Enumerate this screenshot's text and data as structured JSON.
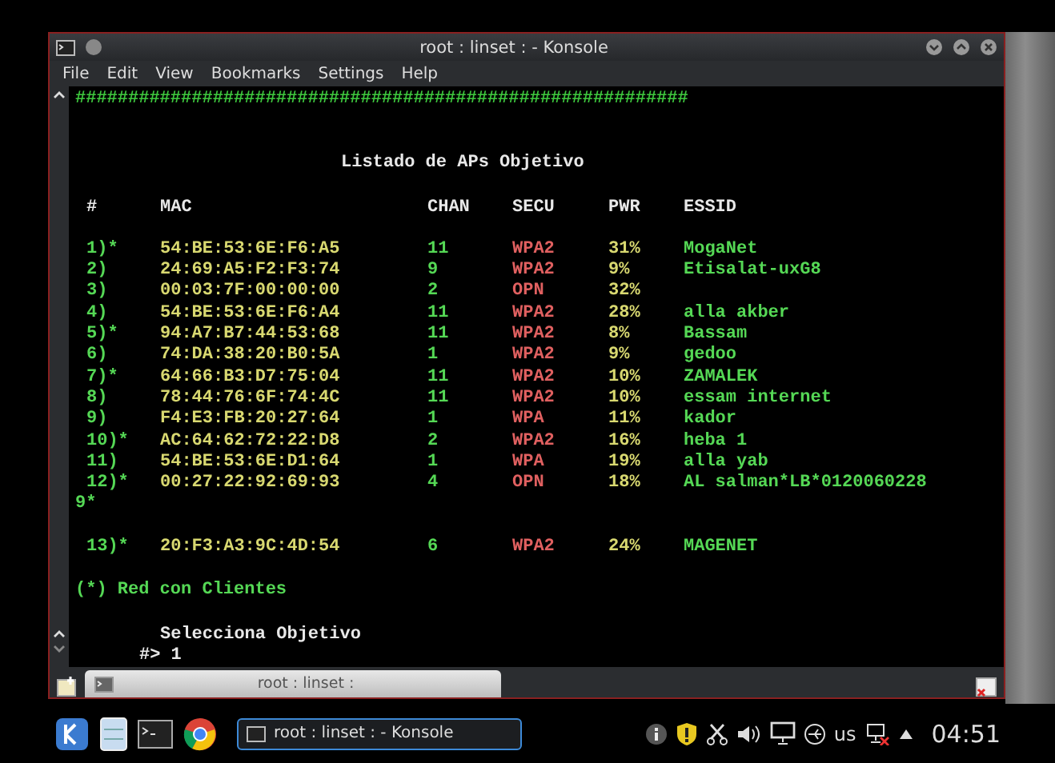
{
  "window": {
    "title": "root : linset :  - Konsole",
    "tab": "root : linset :"
  },
  "menu": [
    "File",
    "Edit",
    "View",
    "Bookmarks",
    "Settings",
    "Help"
  ],
  "terminal": {
    "banner": "##########################################################",
    "heading": "Listado de APs Objetivo",
    "columns": [
      "#",
      "MAC",
      "CHAN",
      "SECU",
      "PWR",
      "ESSID"
    ],
    "rows": [
      {
        "kind": "ap",
        "num": "1)*",
        "mac": "54:BE:53:6E:F6:A5",
        "chan": "11",
        "secu": "WPA2",
        "pwr": "31%",
        "essid": "MogaNet"
      },
      {
        "kind": "ap",
        "num": "2)",
        "mac": "24:69:A5:F2:F3:74",
        "chan": "9",
        "secu": "WPA2",
        "pwr": "9%",
        "essid": "Etisalat-uxG8"
      },
      {
        "kind": "ap",
        "num": "3)",
        "mac": "00:03:7F:00:00:00",
        "chan": "2",
        "secu": "OPN",
        "pwr": "32%"
      },
      {
        "kind": "ap",
        "num": "4)",
        "mac": "54:BE:53:6E:F6:A4",
        "chan": "11",
        "secu": "WPA2",
        "pwr": "28%",
        "essid": "alla akber"
      },
      {
        "kind": "ap",
        "num": "5)*",
        "mac": "94:A7:B7:44:53:68",
        "chan": "11",
        "secu": "WPA2",
        "pwr": "8%",
        "essid": "Bassam"
      },
      {
        "kind": "ap",
        "num": "6)",
        "mac": "74:DA:38:20:B0:5A",
        "chan": "1",
        "secu": "WPA2",
        "pwr": "9%",
        "essid": "gedoo"
      },
      {
        "kind": "ap",
        "num": "7)*",
        "mac": "64:66:B3:D7:75:04",
        "chan": "11",
        "secu": "WPA2",
        "pwr": "10%",
        "essid": "ZAMALEK"
      },
      {
        "kind": "ap",
        "num": "8)",
        "mac": "78:44:76:6F:74:4C",
        "chan": "11",
        "secu": "WPA2",
        "pwr": "10%",
        "essid": "essam internet"
      },
      {
        "kind": "ap",
        "num": "9)",
        "mac": "F4:E3:FB:20:27:64",
        "chan": "1",
        "secu": "WPA",
        "pwr": "11%",
        "essid": "kador"
      },
      {
        "kind": "ap",
        "num": "10)*",
        "mac": "AC:64:62:72:22:D8",
        "chan": "2",
        "secu": "WPA2",
        "pwr": "16%",
        "essid": "heba 1"
      },
      {
        "kind": "ap",
        "num": "11)",
        "mac": "54:BE:53:6E:D1:64",
        "chan": "1",
        "secu": "WPA",
        "pwr": "19%",
        "essid": "alla yab"
      },
      {
        "kind": "ap",
        "num": "12)*",
        "mac": "00:27:22:92:69:93",
        "chan": "4",
        "secu": "OPN",
        "pwr": "18%",
        "essid": "AL salman*LB*0120060228"
      },
      {
        "kind": "wrap",
        "text": "9*"
      },
      {
        "kind": "blank"
      },
      {
        "kind": "ap",
        "num": "13)*",
        "mac": "20:F3:A3:9C:4D:54",
        "chan": "6",
        "secu": "WPA2",
        "pwr": "24%",
        "essid": "MAGENET"
      }
    ],
    "note": "(*) Red con Clientes",
    "prompt_label": "Selecciona Objetivo",
    "prompt": "#> 1"
  },
  "taskbar": {
    "task": "root : linset :  - Konsole",
    "keyboard": "us",
    "clock": "04:51"
  }
}
